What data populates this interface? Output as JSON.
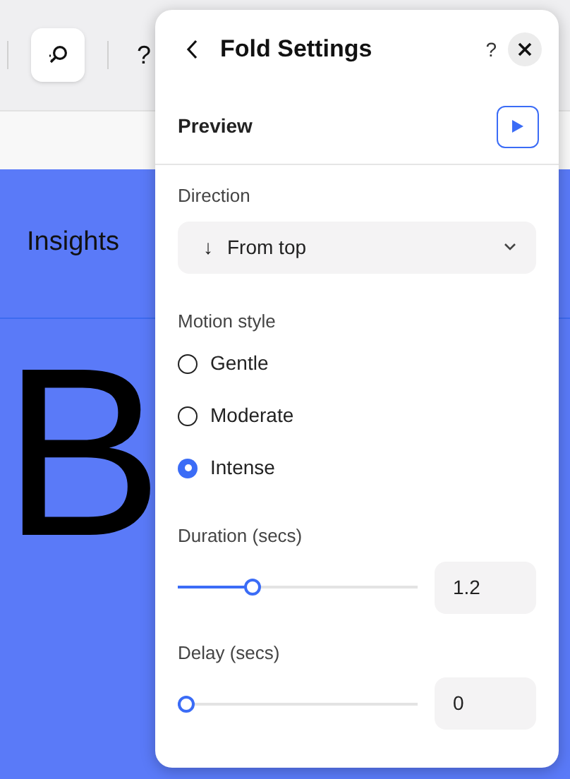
{
  "toolbar": {
    "help_label": "?"
  },
  "site": {
    "nav_item": "Insights",
    "headline": "B"
  },
  "panel": {
    "title": "Fold Settings",
    "help_label": "?",
    "preview_label": "Preview",
    "direction": {
      "label": "Direction",
      "value": "From top",
      "arrow": "↓"
    },
    "motion_style": {
      "label": "Motion style",
      "options": [
        {
          "label": "Gentle",
          "selected": false
        },
        {
          "label": "Moderate",
          "selected": false
        },
        {
          "label": "Intense",
          "selected": true
        }
      ]
    },
    "sliders": [
      {
        "label": "Duration (secs)",
        "level": 0.3,
        "value": "1.2"
      },
      {
        "label": "Delay (secs)",
        "level": 0,
        "value": "0"
      }
    ]
  }
}
